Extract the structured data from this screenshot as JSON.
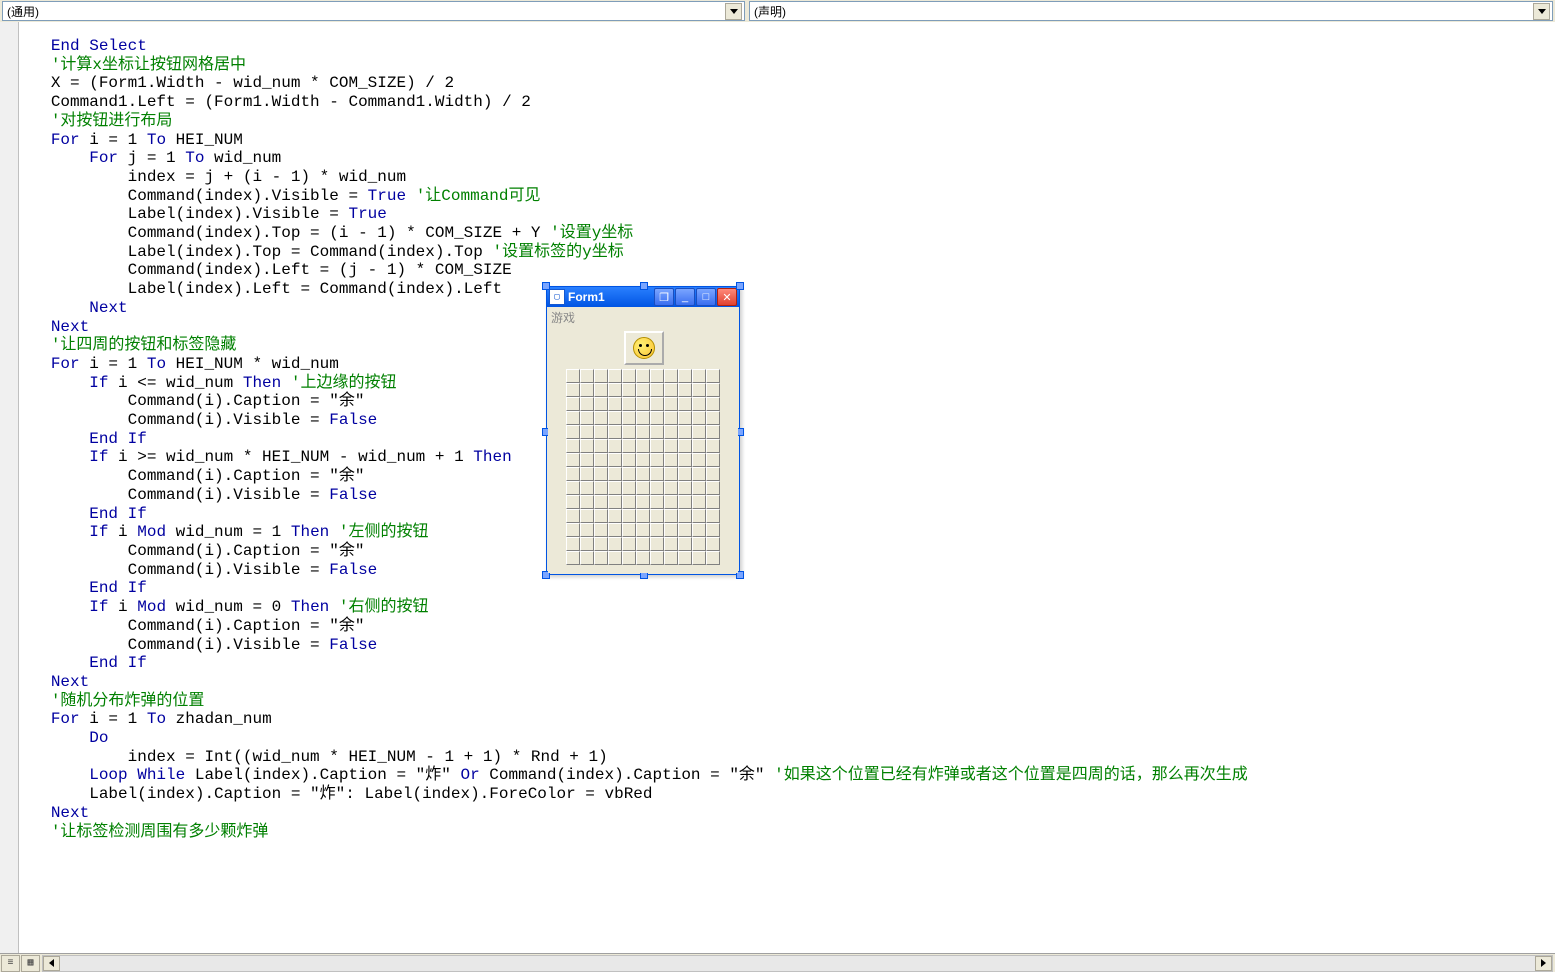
{
  "top": {
    "combo_left": "(通用)",
    "combo_right": "(声明)"
  },
  "form": {
    "title": "Form1",
    "menu": "游戏",
    "grid_cols": 11,
    "grid_rows": 14
  },
  "code_lines": [
    {
      "indent": "   ",
      "tokens": [
        {
          "t": "End Select",
          "c": "kw"
        }
      ]
    },
    {
      "indent": "",
      "tokens": [
        {
          "t": "",
          "c": "n"
        }
      ]
    },
    {
      "indent": "   ",
      "tokens": [
        {
          "t": "'计算x坐标让按钮网格居中",
          "c": "cm"
        }
      ]
    },
    {
      "indent": "   ",
      "tokens": [
        {
          "t": "X = (Form1.Width - wid_num * COM_SIZE) / 2",
          "c": "n"
        }
      ]
    },
    {
      "indent": "   ",
      "tokens": [
        {
          "t": "Command1.Left = (Form1.Width - Command1.Width) / 2",
          "c": "n"
        }
      ]
    },
    {
      "indent": "   ",
      "tokens": [
        {
          "t": "'对按钮进行布局",
          "c": "cm"
        }
      ]
    },
    {
      "indent": "   ",
      "tokens": [
        {
          "t": "For",
          "c": "kw"
        },
        {
          "t": " i = 1 ",
          "c": "n"
        },
        {
          "t": "To",
          "c": "kw"
        },
        {
          "t": " HEI_NUM",
          "c": "n"
        }
      ]
    },
    {
      "indent": "       ",
      "tokens": [
        {
          "t": "For",
          "c": "kw"
        },
        {
          "t": " j = 1 ",
          "c": "n"
        },
        {
          "t": "To",
          "c": "kw"
        },
        {
          "t": " wid_num",
          "c": "n"
        }
      ]
    },
    {
      "indent": "           ",
      "tokens": [
        {
          "t": "index = j + (i - 1) * wid_num",
          "c": "n"
        }
      ]
    },
    {
      "indent": "           ",
      "tokens": [
        {
          "t": "Command(index).Visible = ",
          "c": "n"
        },
        {
          "t": "True",
          "c": "kw"
        },
        {
          "t": " ",
          "c": "n"
        },
        {
          "t": "'让Command可见",
          "c": "cm"
        }
      ]
    },
    {
      "indent": "           ",
      "tokens": [
        {
          "t": "Label(index).Visible = ",
          "c": "n"
        },
        {
          "t": "True",
          "c": "kw"
        }
      ]
    },
    {
      "indent": "           ",
      "tokens": [
        {
          "t": "Command(index).Top = (i - 1) * COM_SIZE + Y ",
          "c": "n"
        },
        {
          "t": "'设置y坐标",
          "c": "cm"
        }
      ]
    },
    {
      "indent": "           ",
      "tokens": [
        {
          "t": "Label(index).Top = Command(index).Top ",
          "c": "n"
        },
        {
          "t": "'设置标签的y坐标",
          "c": "cm"
        }
      ]
    },
    {
      "indent": "           ",
      "tokens": [
        {
          "t": "Command(index).Left = (j - 1) * COM_SIZE",
          "c": "n"
        }
      ]
    },
    {
      "indent": "           ",
      "tokens": [
        {
          "t": "Label(index).Left = Command(index).Left",
          "c": "n"
        }
      ]
    },
    {
      "indent": "       ",
      "tokens": [
        {
          "t": "Next",
          "c": "kw"
        }
      ]
    },
    {
      "indent": "   ",
      "tokens": [
        {
          "t": "Next",
          "c": "kw"
        }
      ]
    },
    {
      "indent": "   ",
      "tokens": [
        {
          "t": "'让四周的按钮和标签隐藏",
          "c": "cm"
        }
      ]
    },
    {
      "indent": "   ",
      "tokens": [
        {
          "t": "For",
          "c": "kw"
        },
        {
          "t": " i = 1 ",
          "c": "n"
        },
        {
          "t": "To",
          "c": "kw"
        },
        {
          "t": " HEI_NUM * wid_num",
          "c": "n"
        }
      ]
    },
    {
      "indent": "       ",
      "tokens": [
        {
          "t": "If",
          "c": "kw"
        },
        {
          "t": " i <= wid_num ",
          "c": "n"
        },
        {
          "t": "Then",
          "c": "kw"
        },
        {
          "t": " ",
          "c": "n"
        },
        {
          "t": "'上边缘的按钮",
          "c": "cm"
        }
      ]
    },
    {
      "indent": "           ",
      "tokens": [
        {
          "t": "Command(i).Caption = \"余\"",
          "c": "n"
        }
      ]
    },
    {
      "indent": "           ",
      "tokens": [
        {
          "t": "Command(i).Visible = ",
          "c": "n"
        },
        {
          "t": "False",
          "c": "kw"
        }
      ]
    },
    {
      "indent": "       ",
      "tokens": [
        {
          "t": "End If",
          "c": "kw"
        }
      ]
    },
    {
      "indent": "       ",
      "tokens": [
        {
          "t": "If",
          "c": "kw"
        },
        {
          "t": " i >= wid_num * HEI_NUM - wid_num + 1 ",
          "c": "n"
        },
        {
          "t": "Then",
          "c": "kw"
        }
      ]
    },
    {
      "indent": "           ",
      "tokens": [
        {
          "t": "Command(i).Caption = \"余\"",
          "c": "n"
        }
      ]
    },
    {
      "indent": "           ",
      "tokens": [
        {
          "t": "Command(i).Visible = ",
          "c": "n"
        },
        {
          "t": "False",
          "c": "kw"
        }
      ]
    },
    {
      "indent": "       ",
      "tokens": [
        {
          "t": "End If",
          "c": "kw"
        }
      ]
    },
    {
      "indent": "       ",
      "tokens": [
        {
          "t": "If",
          "c": "kw"
        },
        {
          "t": " i ",
          "c": "n"
        },
        {
          "t": "Mod",
          "c": "kw"
        },
        {
          "t": " wid_num = 1 ",
          "c": "n"
        },
        {
          "t": "Then",
          "c": "kw"
        },
        {
          "t": " ",
          "c": "n"
        },
        {
          "t": "'左侧的按钮",
          "c": "cm"
        }
      ]
    },
    {
      "indent": "           ",
      "tokens": [
        {
          "t": "Command(i).Caption = \"余\"",
          "c": "n"
        }
      ]
    },
    {
      "indent": "           ",
      "tokens": [
        {
          "t": "Command(i).Visible = ",
          "c": "n"
        },
        {
          "t": "False",
          "c": "kw"
        }
      ]
    },
    {
      "indent": "       ",
      "tokens": [
        {
          "t": "End If",
          "c": "kw"
        }
      ]
    },
    {
      "indent": "       ",
      "tokens": [
        {
          "t": "If",
          "c": "kw"
        },
        {
          "t": " i ",
          "c": "n"
        },
        {
          "t": "Mod",
          "c": "kw"
        },
        {
          "t": " wid_num = 0 ",
          "c": "n"
        },
        {
          "t": "Then",
          "c": "kw"
        },
        {
          "t": " ",
          "c": "n"
        },
        {
          "t": "'右侧的按钮",
          "c": "cm"
        }
      ]
    },
    {
      "indent": "           ",
      "tokens": [
        {
          "t": "Command(i).Caption = \"余\"",
          "c": "n"
        }
      ]
    },
    {
      "indent": "           ",
      "tokens": [
        {
          "t": "Command(i).Visible = ",
          "c": "n"
        },
        {
          "t": "False",
          "c": "kw"
        }
      ]
    },
    {
      "indent": "       ",
      "tokens": [
        {
          "t": "End If",
          "c": "kw"
        }
      ]
    },
    {
      "indent": "   ",
      "tokens": [
        {
          "t": "Next",
          "c": "kw"
        }
      ]
    },
    {
      "indent": "   ",
      "tokens": [
        {
          "t": "'随机分布炸弹的位置",
          "c": "cm"
        }
      ]
    },
    {
      "indent": "   ",
      "tokens": [
        {
          "t": "For",
          "c": "kw"
        },
        {
          "t": " i = 1 ",
          "c": "n"
        },
        {
          "t": "To",
          "c": "kw"
        },
        {
          "t": " zhadan_num",
          "c": "n"
        }
      ]
    },
    {
      "indent": "       ",
      "tokens": [
        {
          "t": "Do",
          "c": "kw"
        }
      ]
    },
    {
      "indent": "           ",
      "tokens": [
        {
          "t": "index = Int((wid_num * HEI_NUM - 1 + 1) * Rnd + 1)",
          "c": "n"
        }
      ]
    },
    {
      "indent": "       ",
      "tokens": [
        {
          "t": "Loop While",
          "c": "kw"
        },
        {
          "t": " Label(index).Caption = \"炸\" ",
          "c": "n"
        },
        {
          "t": "Or",
          "c": "kw"
        },
        {
          "t": " Command(index).Caption = \"余\" ",
          "c": "n"
        },
        {
          "t": "'如果这个位置已经有炸弹或者这个位置是四周的话，那么再次生成",
          "c": "cm"
        }
      ]
    },
    {
      "indent": "       ",
      "tokens": [
        {
          "t": "Label(index).Caption = \"炸\": Label(index).ForeColor = vbRed",
          "c": "n"
        }
      ]
    },
    {
      "indent": "   ",
      "tokens": [
        {
          "t": "Next",
          "c": "kw"
        }
      ]
    },
    {
      "indent": "   ",
      "tokens": [
        {
          "t": "'让标签检测周围有多少颗炸弹",
          "c": "cm"
        }
      ]
    }
  ]
}
